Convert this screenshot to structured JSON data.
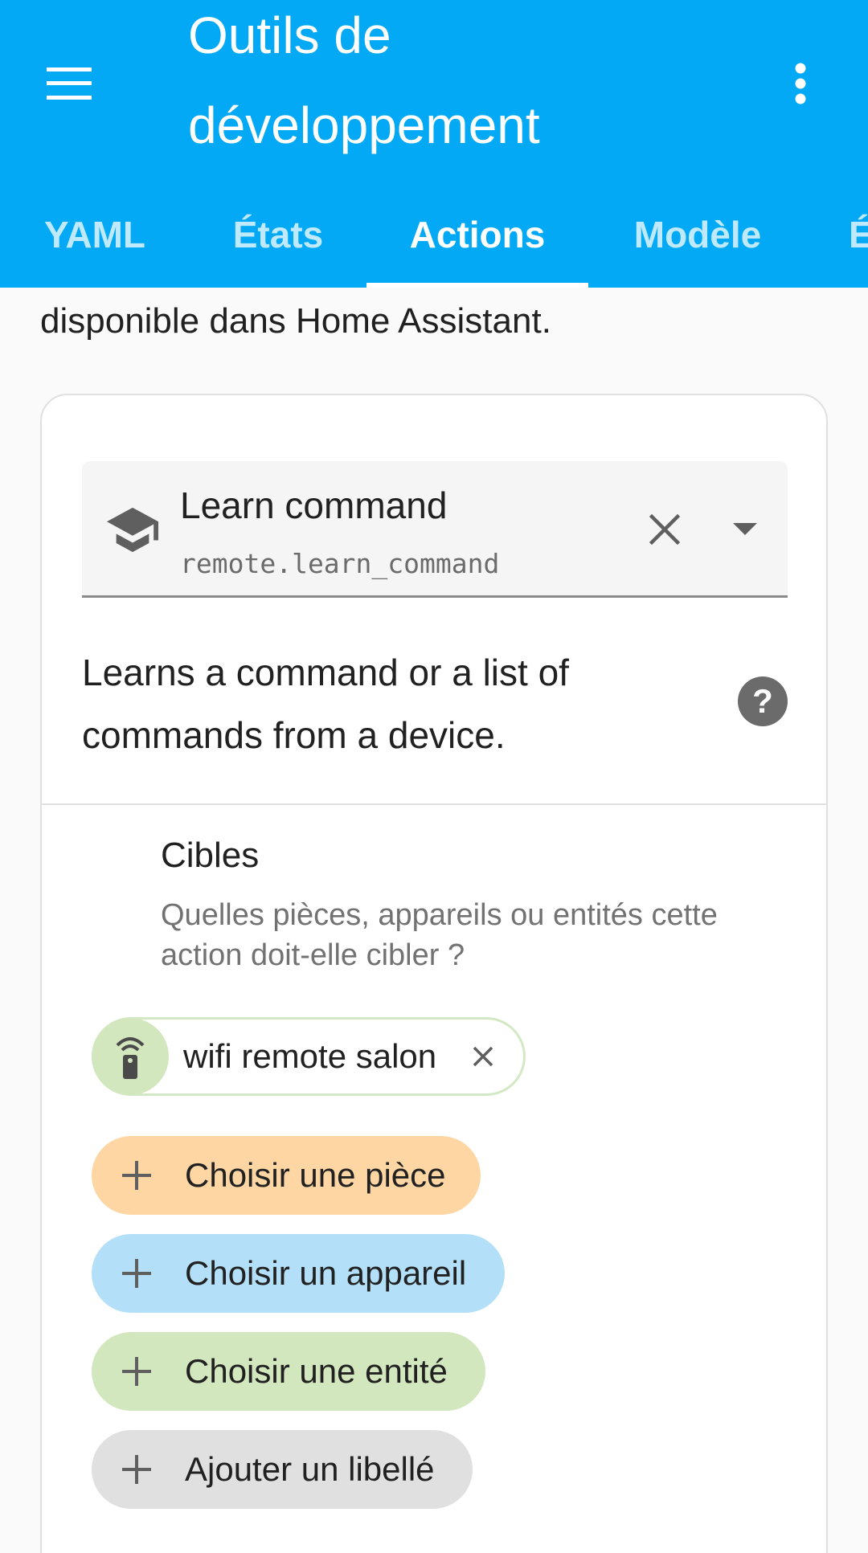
{
  "header": {
    "title": "Outils de développement",
    "menu_icon": "menu-icon",
    "more_icon": "dots-vertical-icon"
  },
  "tabs": [
    {
      "label": "YAML",
      "active": false
    },
    {
      "label": "États",
      "active": false
    },
    {
      "label": "Actions",
      "active": true
    },
    {
      "label": "Modèle",
      "active": false
    },
    {
      "label": "É",
      "active": false
    }
  ],
  "intro_text": "disponible dans Home Assistant.",
  "action_picker": {
    "name": "Learn command",
    "id": "remote.learn_command",
    "icon": "school-icon",
    "clear_icon": "close-icon",
    "caret_icon": "menu-down-icon"
  },
  "description": "Learns a command or a list of commands from a device.",
  "help_icon": "help-circle-icon",
  "targets": {
    "title": "Cibles",
    "description": "Quelles pièces, appareils ou entités cette action doit-elle cibler ?",
    "selected_entity": "wifi remote salon",
    "add_room": "Choisir une pièce",
    "add_device": "Choisir un appareil",
    "add_entity": "Choisir une entité",
    "add_label": "Ajouter un libellé"
  },
  "colors": {
    "primary": "#03a9f4",
    "room_chip": "#fed6a4",
    "device_chip": "#b3e0f8",
    "entity_chip": "#d2e7bd",
    "label_chip": "#e0e0e0"
  }
}
